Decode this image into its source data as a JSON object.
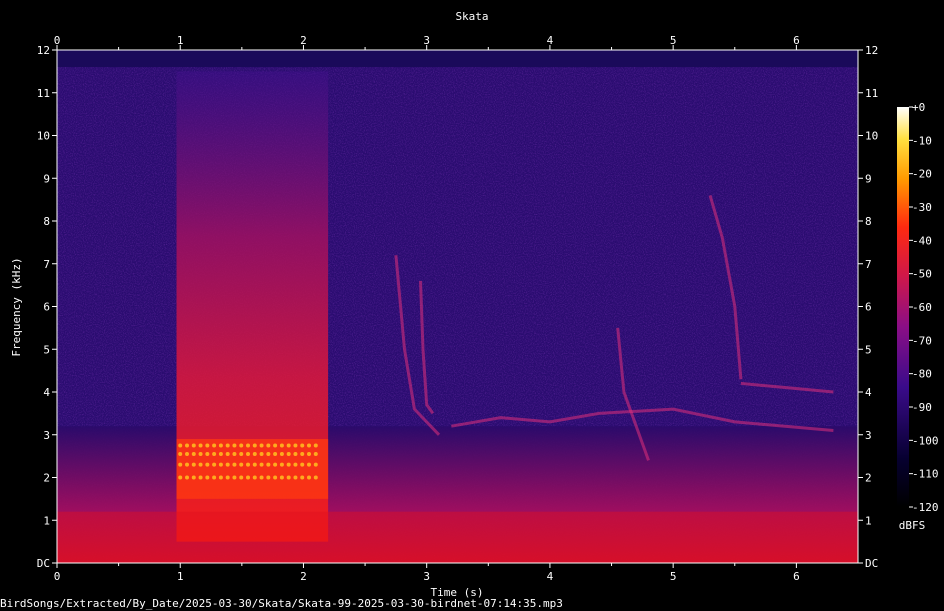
{
  "chart_data": {
    "type": "heatmap",
    "title": "Skata",
    "xlabel": "Time (s)",
    "ylabel": "Frequency (kHz)",
    "x_ticks": [
      "0",
      "1",
      "2",
      "3",
      "4",
      "5",
      "6"
    ],
    "y_ticks": [
      "DC",
      "1",
      "2",
      "3",
      "4",
      "5",
      "6",
      "7",
      "8",
      "9",
      "10",
      "11",
      "12"
    ],
    "xlim": [
      0,
      6.5
    ],
    "ylim": [
      0,
      12
    ],
    "colorbar": {
      "label": "dBFS",
      "ticks": [
        "+0",
        "-10",
        "-20",
        "-30",
        "-40",
        "-50",
        "-60",
        "-70",
        "-80",
        "-90",
        "-100",
        "-110",
        "-120"
      ],
      "range": [
        -120,
        0
      ]
    },
    "grid": false,
    "features": [
      {
        "desc": "broadband burst",
        "t_start": 0.97,
        "t_end": 2.2,
        "f_low_khz": 0.5,
        "f_high_khz": 11.5,
        "level_dbfs": -65
      },
      {
        "desc": "strong harmonics",
        "t_start": 0.97,
        "t_end": 2.2,
        "f_low_khz": 1.5,
        "f_high_khz": 2.9,
        "level_dbfs": -35
      },
      {
        "desc": "low frequency energy",
        "t_start": 0,
        "t_end": 6.5,
        "f_low_khz": 0,
        "f_high_khz": 1.2,
        "level_dbfs": -60
      }
    ]
  },
  "footer": {
    "path": "BirdSongs/Extracted/By_Date/2025-03-30/Skata/Skata-99-2025-03-30-birdnet-07:14:35.mp3"
  }
}
